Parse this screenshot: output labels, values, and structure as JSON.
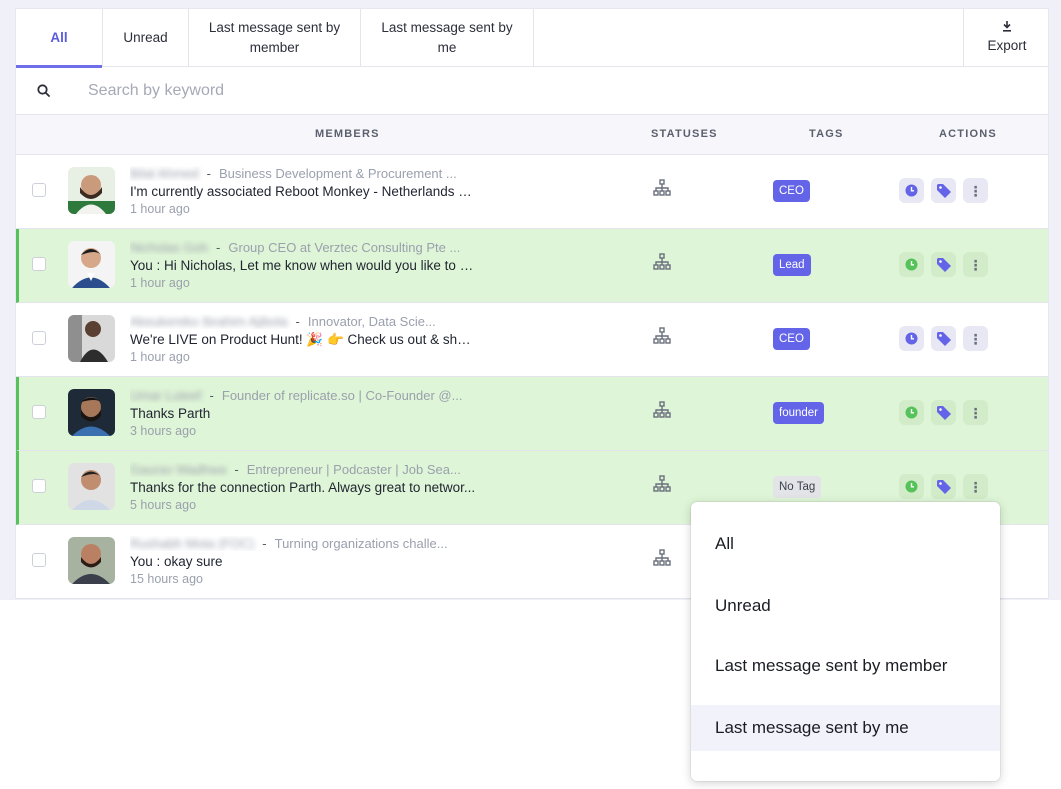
{
  "tabs": {
    "all": "All",
    "unread": "Unread",
    "by_member": "Last message sent by member",
    "by_me": "Last message sent by me",
    "export": "Export"
  },
  "search": {
    "placeholder": "Search by keyword"
  },
  "table": {
    "headers": {
      "members": "MEMBERS",
      "statuses": "STATUSES",
      "tags": "TAGS",
      "actions": "ACTIONS"
    },
    "rows": [
      {
        "name": "Bilal Ahmed",
        "headline": "Business Development & Procurement ...",
        "message": "I'm currently associated Reboot Monkey - Netherlands based...",
        "time": "1 hour ago",
        "tag": "CEO",
        "highlighted": false,
        "clock_color": "#6364e8"
      },
      {
        "name": "Nicholas Goh",
        "headline": "Group CEO at Verztec Consulting Pte ...",
        "message": "You : Hi Nicholas, Let me know when would you like to try...",
        "time": "1 hour ago",
        "tag": "Lead",
        "highlighted": true,
        "clock_color": "#55c35a"
      },
      {
        "name": "Akeukereko Ibrahim Ajibola",
        "headline": "Innovator, Data Scie...",
        "message": "We're LIVE on Product Hunt! 🎉 👉 Check us out & show ...",
        "time": "1 hour ago",
        "tag": "CEO",
        "highlighted": false,
        "clock_color": "#6364e8"
      },
      {
        "name": "Umar Luteef",
        "headline": "Founder of replicate.so | Co-Founder @...",
        "message": "Thanks Parth",
        "time": "3 hours ago",
        "tag": "founder",
        "highlighted": true,
        "clock_color": "#55c35a"
      },
      {
        "name": "Gaurav Wadhwa",
        "headline": "Entrepreneur | Podcaster | Job Sea...",
        "message": "Thanks for the connection Parth. Always great to networ...",
        "time": "5 hours ago",
        "tag": "No Tag",
        "highlighted": true,
        "clock_color": "#55c35a"
      },
      {
        "name": "Rushabh Mota (FOC)",
        "headline": "Turning organizations challe...",
        "message": "You : okay sure",
        "time": "15 hours ago",
        "tag": "",
        "highlighted": false,
        "clock_color": "#6364e8"
      }
    ]
  },
  "dropdown": {
    "items": [
      "All",
      "Unread",
      "Last message sent by member",
      "Last message sent by me"
    ],
    "hovered_index": 3
  },
  "colors": {
    "accent": "#6364e8",
    "highlight_row": "#dff5d7",
    "highlight_border": "#57c15d",
    "green_clock": "#55c35a"
  }
}
